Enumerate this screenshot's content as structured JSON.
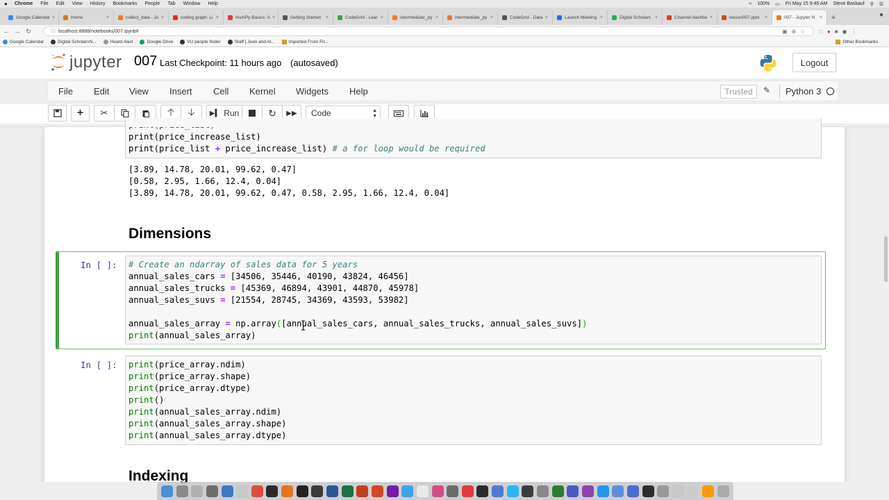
{
  "mac_menubar": {
    "apple": "",
    "items": [
      "Chrome",
      "File",
      "Edit",
      "View",
      "History",
      "Bookmarks",
      "People",
      "Tab",
      "Window",
      "Help"
    ],
    "battery": "100%",
    "datetime": "Fri May 15  9:45 AM",
    "user": "Steve Baskauf"
  },
  "browser": {
    "tabs": [
      {
        "label": "Google Calendar",
        "color": "#4285f4"
      },
      {
        "label": "Home",
        "color": "#e37400"
      },
      {
        "label": "collect_data - Ju",
        "color": "#f37726"
      },
      {
        "label": "coding graph: Li",
        "color": "#d93025"
      },
      {
        "label": "NumPy Basics: A",
        "color": "#e53935"
      },
      {
        "label": "Getting Started",
        "color": "#555555"
      },
      {
        "label": "CodeGrid - Lear",
        "color": "#43a047"
      },
      {
        "label": "intermediate_py",
        "color": "#f37726"
      },
      {
        "label": "intermediate_py",
        "color": "#f37726"
      },
      {
        "label": "CodeGrid - Data",
        "color": "#555555"
      },
      {
        "label": "Launch Meeting",
        "color": "#1a73e8"
      },
      {
        "label": "Digital Scholars",
        "color": "#34a853"
      },
      {
        "label": "Channel dashbo",
        "color": "#e53935"
      },
      {
        "label": "lesson007.pptx",
        "color": "#d24726"
      },
      {
        "label": "007 - Jupyter N",
        "color": "#f37726"
      }
    ],
    "url": "localhost:8888/notebooks/007.ipynb#",
    "bookmarks": [
      "Google Calendar",
      "Digital Scholarshi...",
      "Heard Alert",
      "Google Drive",
      "VU people finder",
      "Staff | Jean and Al...",
      "Imported From Fir..."
    ],
    "other_bookmarks": "Other Bookmarks"
  },
  "header": {
    "logo_text": "jupyter",
    "notebook_name": "007",
    "checkpoint": "Last Checkpoint: 11 hours ago",
    "autosaved": "(autosaved)",
    "logout": "Logout"
  },
  "menubar": {
    "file": "File",
    "edit": "Edit",
    "view": "View",
    "insert": "Insert",
    "cell": "Cell",
    "kernel": "Kernel",
    "widgets": "Widgets",
    "help": "Help",
    "trusted": "Trusted",
    "kernel_name": "Python 3"
  },
  "toolbar": {
    "run_label": "Run",
    "cell_type": "Code"
  },
  "cells": {
    "top_code": {
      "line0": "print(price_list)",
      "line1": "print(price_increase_list)",
      "line2_a": "print(price_list ",
      "line2_op": "+",
      "line2_b": " price_increase_list) ",
      "line2_comment": "# a for loop would be required"
    },
    "top_output": [
      "[3.89, 14.78, 20.01, 99.62, 0.47]",
      "[0.58, 2.95, 1.66, 12.4, 0.04]",
      "[3.89, 14.78, 20.01, 99.62, 0.47, 0.58, 2.95, 1.66, 12.4, 0.04]"
    ],
    "dimensions_heading": "Dimensions",
    "cell2": {
      "prompt": "In [ ]:",
      "comment": "# Create an ndarray of sales data for 5 years",
      "cars_name": "annual_sales_cars ",
      "cars_vals": "[34506, 35446, 40190, 43824, 46456]",
      "trucks_name": "annual_sales_trucks ",
      "trucks_vals": "[45369, 46894, 43901, 44870, 45978]",
      "suvs_name": "annual_sales_suvs ",
      "suvs_vals": "[21554, 28745, 34369, 43593, 53982]",
      "array_a": "annual_sales_array ",
      "array_b": " np.array",
      "array_c": "[annual_sales_cars, annual_sales_trucks, annual_sales_suvs]",
      "print_last_a": "print",
      "print_last_b": "(annual_sales_array)"
    },
    "cell3": {
      "prompt": "In [ ]:",
      "lines": [
        [
          "print",
          "(price_array.ndim)"
        ],
        [
          "print",
          "(price_array.shape)"
        ],
        [
          "print",
          "(price_array.dtype)"
        ],
        [
          "print",
          "()"
        ],
        [
          "print",
          "(annual_sales_array.ndim)"
        ],
        [
          "print",
          "(annual_sales_array.shape)"
        ],
        [
          "print",
          "(annual_sales_array.dtype)"
        ]
      ]
    },
    "indexing_heading": "Indexing"
  },
  "colors": {
    "prompt": "#303f9f",
    "selected_border": "#42a047",
    "keyword": "#008000",
    "comment": "#408080",
    "operator": "#aa22ff"
  },
  "dock": {
    "icon_colors": [
      "#4a90d9",
      "#8a8a8a",
      "#b0b0b0",
      "#6d6d6d",
      "#3b79c7",
      "#c8c8c8",
      "#e04b3a",
      "#2b2b2b",
      "#e8731a",
      "#222222",
      "#3a3a3a",
      "#2b5797",
      "#1e7145",
      "#c43e1c",
      "#d24726",
      "#7719aa",
      "#3da3ea",
      "#e9e9e9",
      "#d34d85",
      "#6b6b6b",
      "#e03a3a",
      "#2b2b2b",
      "#4c7bd1",
      "#29b6f6",
      "#3c3c3c",
      "#888888",
      "#2e7d32",
      "#4a5ac4",
      "#8e44ad",
      "#2196f3",
      "#5d8fd8",
      "#4a6cd1",
      "#2d2d2d",
      "#999999",
      "#c8c8c8",
      "#cccccc",
      "#ff9800",
      "#aaaaaa"
    ]
  }
}
